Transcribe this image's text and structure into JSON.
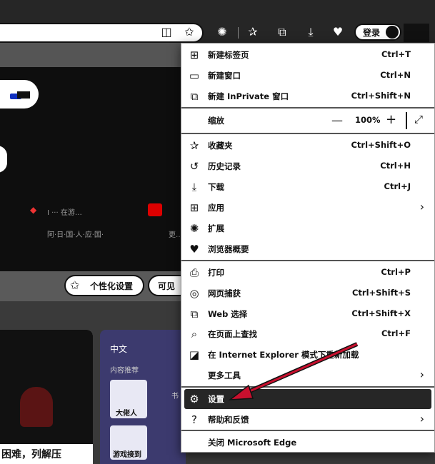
{
  "toolbar": {
    "login_label": "登录"
  },
  "page": {
    "tile1_label": "I ··· 在游…",
    "tile1_sub": "阿·日·国·人·应·国·",
    "tile2_sub": "更…",
    "personalize_label": "个性化设置",
    "visible_label": "可见"
  },
  "feed": {
    "card1_title": "困难，列解压",
    "card2_title": "中文",
    "card2_sub": "内容推荐",
    "card2_item1": "大佬人",
    "card2_item2": "游戏接到",
    "card2_side": "书"
  },
  "menu": {
    "items": [
      {
        "label": "新建标签页",
        "shortcut": "Ctrl+T",
        "icon": "new-tab-icon"
      },
      {
        "label": "新建窗口",
        "shortcut": "Ctrl+N",
        "icon": "new-window-icon"
      },
      {
        "label": "新建 InPrivate 窗口",
        "shortcut": "Ctrl+Shift+N",
        "icon": "inprivate-icon"
      },
      {
        "label": "缩放",
        "icon": ""
      },
      {
        "label": "收藏夹",
        "shortcut": "Ctrl+Shift+O",
        "icon": "favorites-icon"
      },
      {
        "label": "历史记录",
        "shortcut": "Ctrl+H",
        "icon": "history-icon"
      },
      {
        "label": "下载",
        "shortcut": "Ctrl+J",
        "icon": "download-icon"
      },
      {
        "label": "应用",
        "icon": "apps-icon"
      },
      {
        "label": "扩展",
        "icon": "extensions-icon"
      },
      {
        "label": "浏览器概要",
        "icon": "browser-essentials-icon"
      },
      {
        "label": "打印",
        "shortcut": "Ctrl+P",
        "icon": "print-icon"
      },
      {
        "label": "网页捕获",
        "shortcut": "Ctrl+Shift+S",
        "icon": "web-capture-icon"
      },
      {
        "label": "Web 选择",
        "shortcut": "Ctrl+Shift+X",
        "icon": "web-select-icon"
      },
      {
        "label": "在页面上查找",
        "shortcut": "Ctrl+F",
        "icon": "find-icon"
      },
      {
        "label": "在 Internet Explorer 模式下重新加载",
        "icon": "ie-mode-icon"
      },
      {
        "label": "更多工具",
        "icon": "more-tools-icon"
      },
      {
        "label": "设置",
        "icon": "settings-icon"
      },
      {
        "label": "帮助和反馈",
        "icon": "help-icon"
      },
      {
        "label": "关闭 Microsoft Edge",
        "icon": ""
      }
    ],
    "zoom_value": "100%",
    "zoom_minus": "—",
    "zoom_plus": "+"
  },
  "colors": {
    "menu_bg": "#ffffff",
    "highlight_bg": "#262626",
    "arrow": "#c8102e"
  }
}
